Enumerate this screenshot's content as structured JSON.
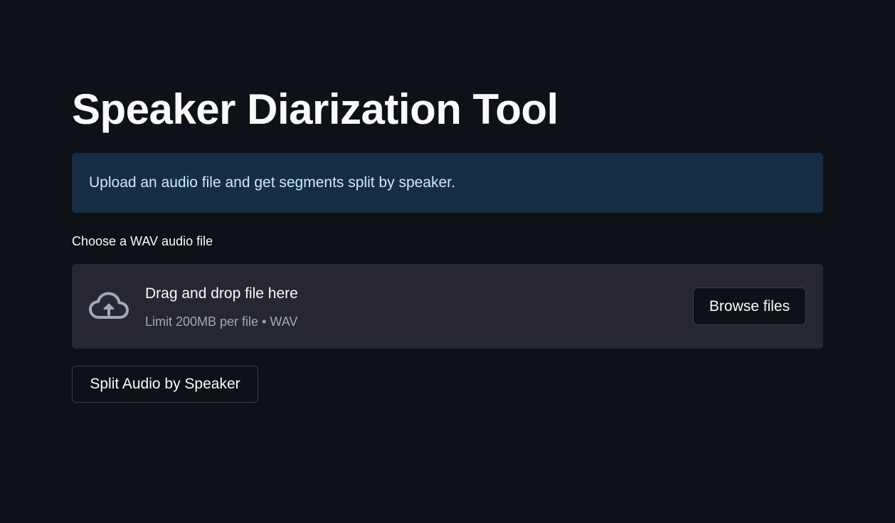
{
  "page": {
    "title": "Speaker Diarization Tool",
    "info_message": "Upload an audio file and get segments split by speaker."
  },
  "uploader": {
    "label": "Choose a WAV audio file",
    "drop_title": "Drag and drop file here",
    "drop_subtitle": "Limit 200MB per file • WAV",
    "browse_label": "Browse files",
    "icon": "cloud-upload-icon"
  },
  "actions": {
    "split_label": "Split Audio by Speaker"
  },
  "colors": {
    "background": "#0e1117",
    "info_background": "#172d43",
    "info_text": "#c7ebff",
    "dropzone_background": "#262730",
    "muted_text": "#a3a8b8"
  }
}
